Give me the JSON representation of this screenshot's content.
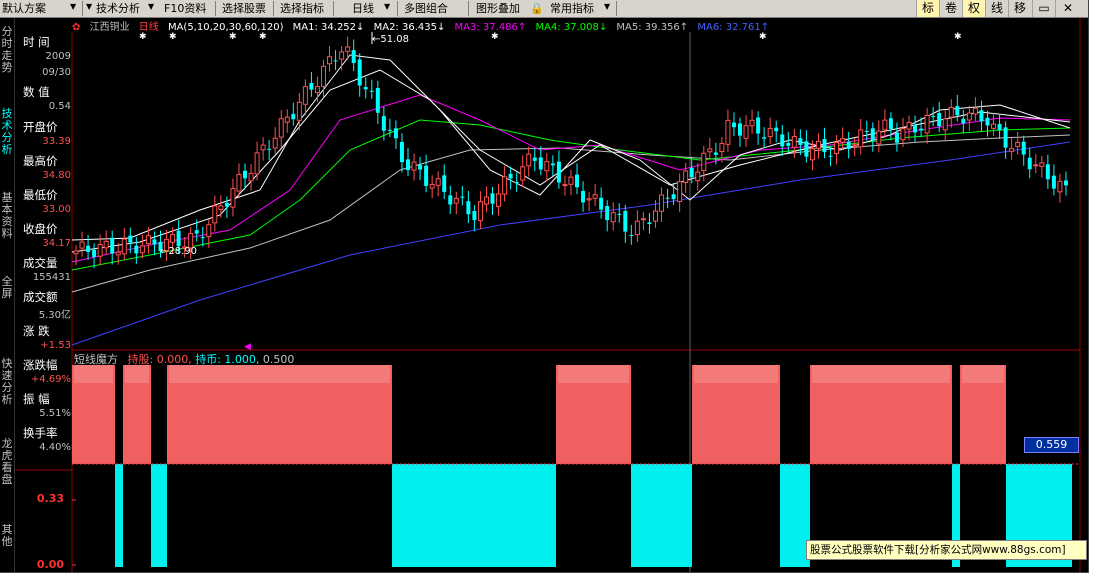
{
  "toolbar": {
    "items": [
      "默认方案",
      "技术分析",
      "F10资料",
      "选择股票",
      "选择指标",
      "日线",
      "多图组合",
      "图形叠加",
      "常用指标"
    ],
    "right": [
      "标",
      "卷",
      "权",
      "线",
      "移"
    ]
  },
  "side_tabs": [
    "分时走势",
    "技术分析",
    "基本资料",
    "全屏",
    "快速分析",
    "龙虎看盘",
    "其他"
  ],
  "stock": {
    "name": "江西铜业",
    "period": "日线"
  },
  "ma_header": {
    "ma": "MA(5,10,20,30,60,120)",
    "ma1": "MA1: 34.252↓",
    "ma2": "MA2: 36.435↓",
    "ma3": "MA3: 37.486↑",
    "ma4": "MA4: 37.008↓",
    "ma5": "MA5: 39.356↑",
    "ma6": "MA6: 32.761↑"
  },
  "info_panel": [
    {
      "label": "时  间",
      "value": "2009"
    },
    {
      "label": "",
      "value": "09/30"
    },
    {
      "label": "数  值",
      "value": "0.54"
    },
    {
      "label": "开盘价",
      "value": "33.39"
    },
    {
      "label": "最高价",
      "value": "34.80"
    },
    {
      "label": "最低价",
      "value": "33.00"
    },
    {
      "label": "收盘价",
      "value": "34.17"
    },
    {
      "label": "成交量",
      "value": "155431"
    },
    {
      "label": "成交额",
      "value": "5.30亿"
    },
    {
      "label": "涨  跌",
      "value": "+1.53"
    },
    {
      "label": "涨跌幅",
      "value": "+4.69%"
    },
    {
      "label": "振  幅",
      "value": "5.51%"
    },
    {
      "label": "换手率",
      "value": "4.40%"
    }
  ],
  "annotations": {
    "high": "51.08",
    "low": "28.90"
  },
  "indicator": {
    "name": "短线魔方",
    "hold_stock": "持股: 0.000,",
    "hold_cash": "持币: 1.000,",
    "value3": "0.500",
    "cursor_value": "0.559",
    "y_labels": [
      "0.33",
      "0.00"
    ]
  },
  "watermark": "股票公式股票软件下载[分析家公式网www.88gs.com]",
  "colors": {
    "up": "#ff5050",
    "down": "#00ffff",
    "hold": "#f06060",
    "cash": "#00f0f0",
    "ma1": "#ffffff",
    "ma2": "#f0f000",
    "ma3": "#ff00ff",
    "ma4": "#00ff00",
    "ma5": "#c0c0c0",
    "ma6": "#4040ff"
  }
}
